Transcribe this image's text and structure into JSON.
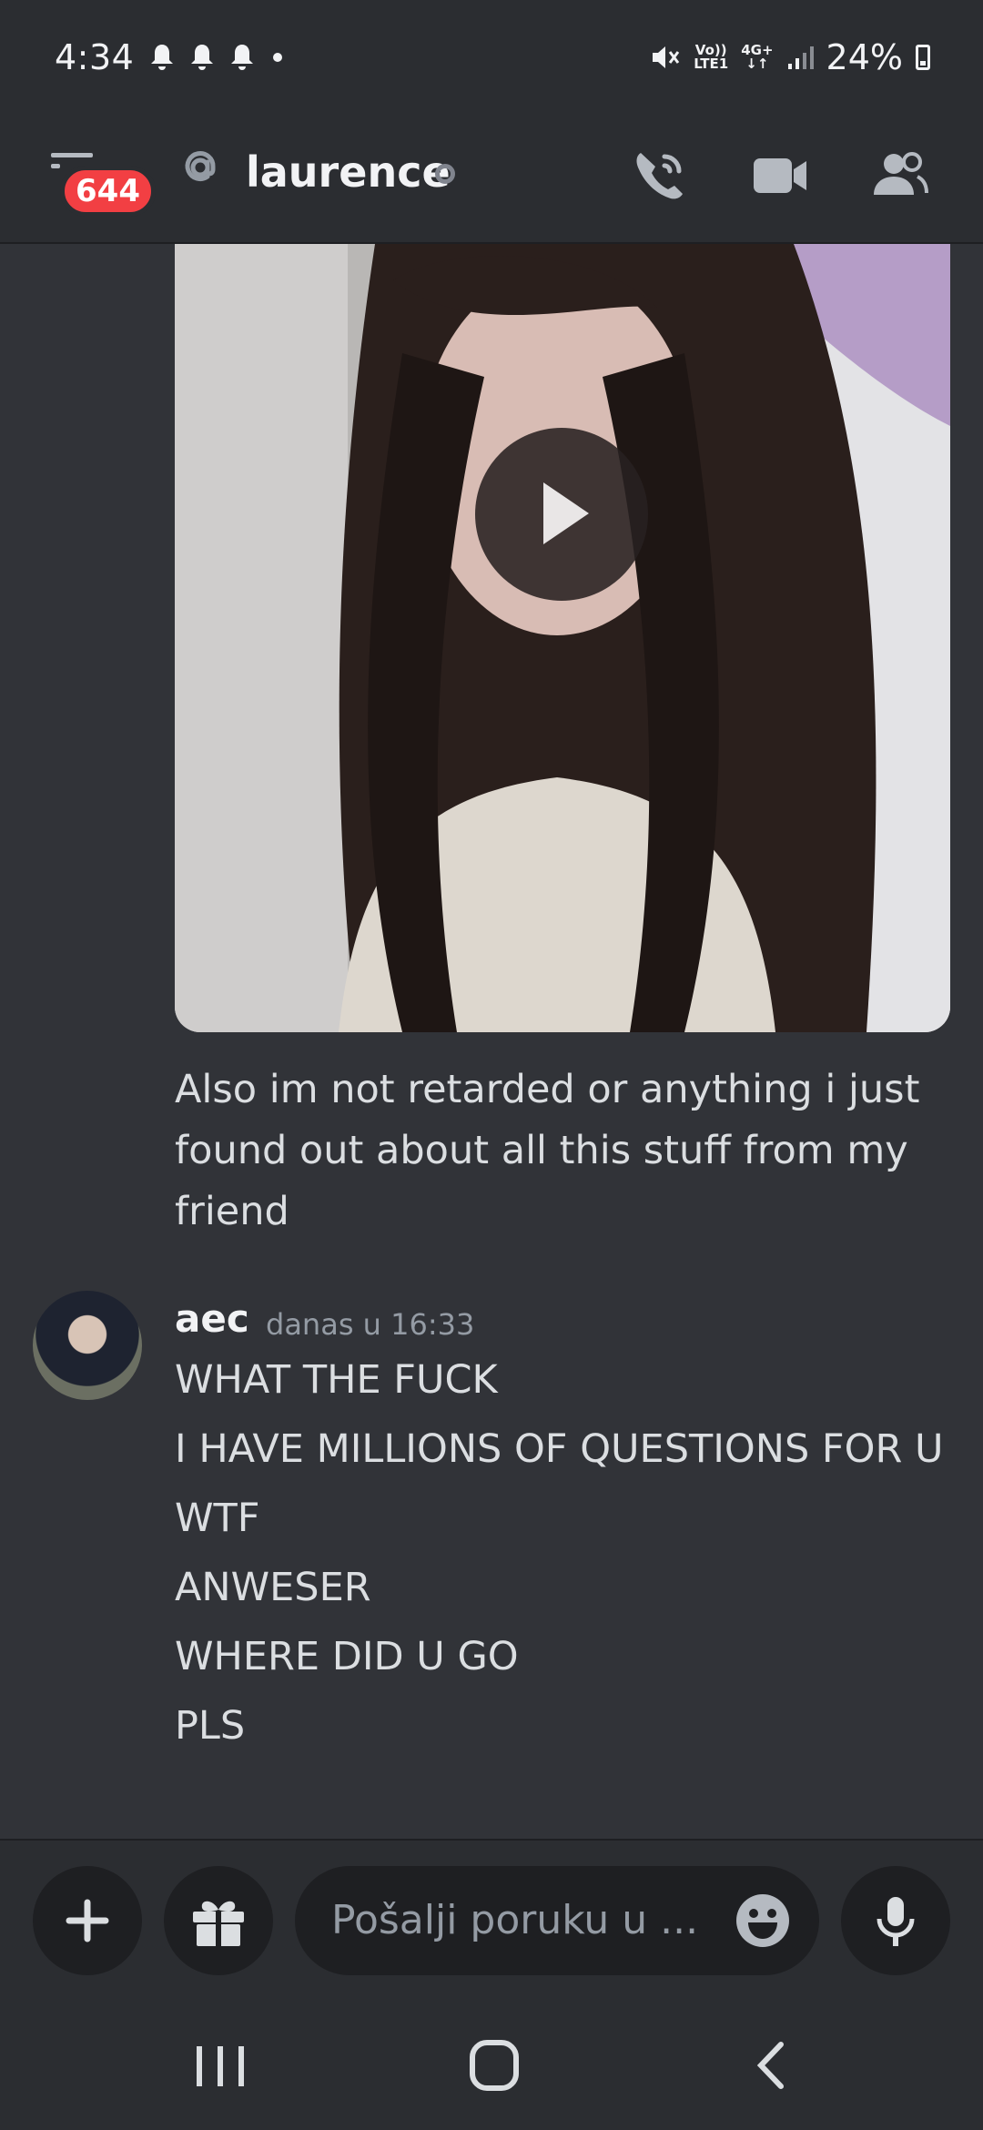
{
  "status_bar": {
    "time": "4:34",
    "network_top": "Vo))",
    "network_bottom": "LTE1",
    "network_type_top": "4G+",
    "network_type_bottom": "↓↑",
    "battery": "24%"
  },
  "header": {
    "unread_badge": "644",
    "channel_name": "laurence",
    "colors": {
      "badge": "#f23f43",
      "background": "#2b2d31"
    }
  },
  "messages": {
    "previous_text": "Also im not retarded or anything i just found out about all this stuff from my friend",
    "group": {
      "author": "aec",
      "timestamp": "danas u 16:33",
      "lines": [
        "WHAT THE FUCK",
        "I HAVE MILLIONS OF QUESTIONS FOR U",
        "WTF",
        "ANWESER",
        "WHERE DID U GO",
        "PLS"
      ]
    }
  },
  "composer": {
    "placeholder": "Pošalji poruku u ..."
  },
  "icons": {
    "menu": "hamburger-icon",
    "at": "at-icon",
    "call": "phone-call-icon",
    "video": "video-camera-icon",
    "members": "members-icon",
    "add": "plus-icon",
    "gift": "gift-icon",
    "emoji": "emoji-icon",
    "mic": "microphone-icon",
    "play": "play-icon"
  }
}
